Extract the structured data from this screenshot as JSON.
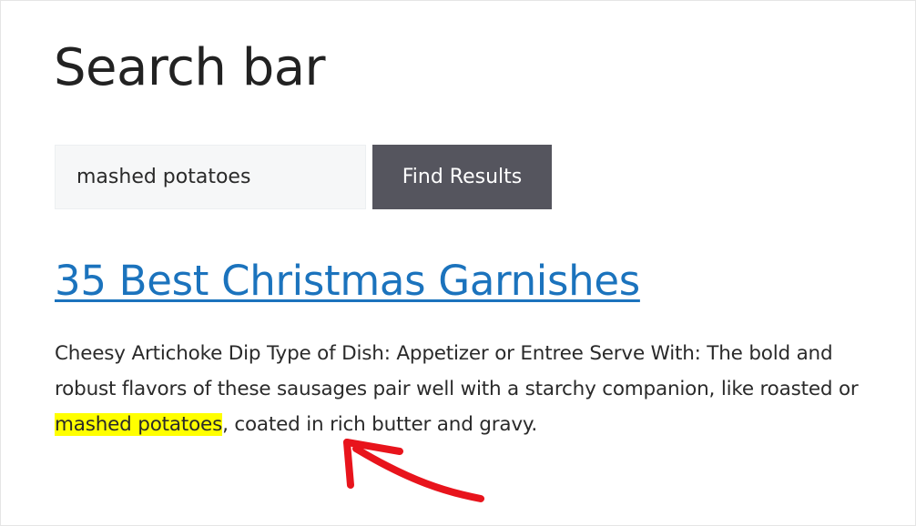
{
  "page": {
    "title": "Search bar"
  },
  "search": {
    "value": "mashed potatoes",
    "button_label": "Find Results"
  },
  "result": {
    "title": "35 Best Christmas Garnishes",
    "excerpt_before": "Cheesy Artichoke Dip Type of Dish: Appetizer or Entree Serve With: The bold and robust flavors of these sausages pair well with a starchy companion, like roasted or ",
    "excerpt_highlight": "mashed potatoes",
    "excerpt_after": ", coated in rich butter and gravy."
  },
  "colors": {
    "link": "#1b73bd",
    "button_bg": "#55555e",
    "highlight": "#ffff00",
    "arrow": "#e8141c"
  },
  "annotation": {
    "icon": "red-arrow-icon"
  }
}
